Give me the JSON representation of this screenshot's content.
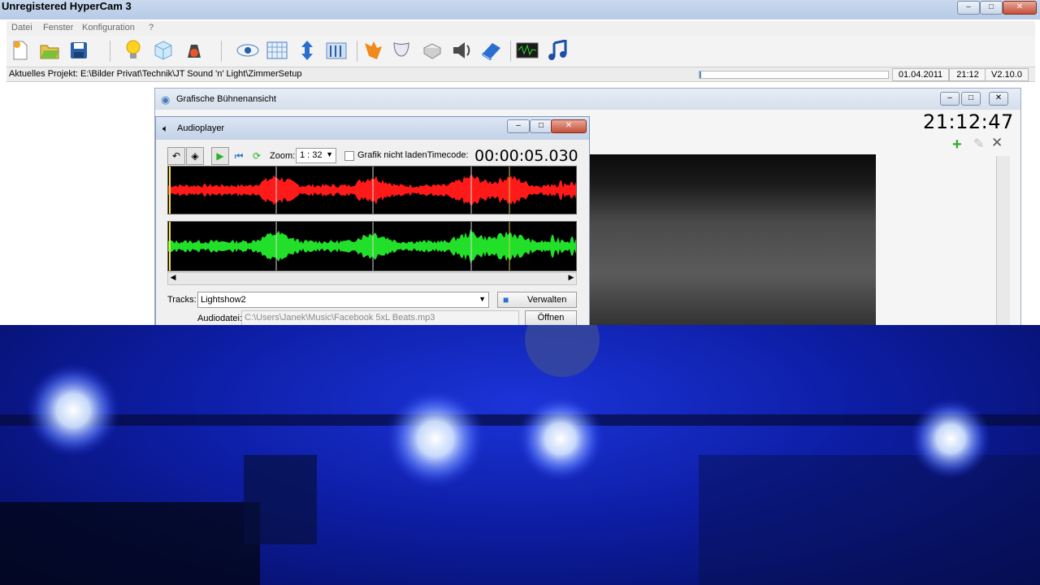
{
  "app": {
    "title": "Unregistered HyperCam 3",
    "window_controls": [
      "–",
      "□",
      "✕"
    ],
    "menu": [
      "Datei",
      "Fenster",
      "Konfiguration",
      "?"
    ],
    "toolbar_icons": [
      "new-document-icon",
      "open-folder-icon",
      "save-icon",
      "lightbulb-icon",
      "cube-icon",
      "moving-head-icon",
      "eye-icon",
      "grid-icon",
      "up-down-arrows-icon",
      "equalizer-icon",
      "flame-icon",
      "masks-icon",
      "box-icon",
      "speaker-icon",
      "book-icon",
      "waveform-monitor-icon",
      "music-note-icon"
    ],
    "status": {
      "project": "Aktuelles Projekt: E:\\Bilder Privat\\Technik\\JT Sound 'n' Light\\ZimmerSetup",
      "progress": 0.01,
      "date": "01.04.2011",
      "time": "21:12",
      "version": "V2.10.0"
    }
  },
  "stage_window": {
    "title": "Grafische Bühnenansicht",
    "clock": "21:12:47"
  },
  "audioplayer": {
    "title": "Audioplayer",
    "zoom_label": "Zoom:",
    "zoom_value": "1 : 32",
    "graphic_checkbox_label": "Grafik nicht laden",
    "timecode_label": "Timecode:",
    "timecode": "00:00:05.030",
    "tracks_label": "Tracks:",
    "track_selected": "Lightshow2",
    "manage_label": "Verwalten",
    "audiofile_label": "Audiodatei:",
    "audiofile_path": "C:\\Users\\Janek\\Music\\Facebook   5xL Beats.mp3",
    "open_label": "Öffnen",
    "colors": {
      "left_channel": "#ff1a1a",
      "right_channel": "#22e02a",
      "marker": "#d8d8d8"
    }
  },
  "photo": {
    "description_free": true
  }
}
